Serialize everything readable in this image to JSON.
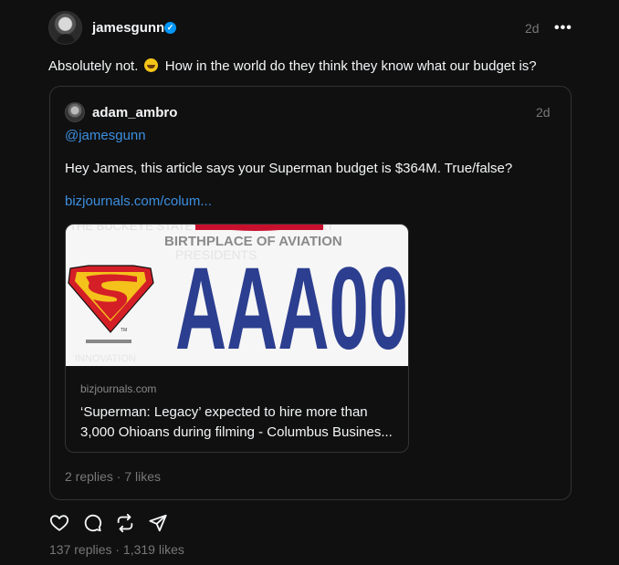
{
  "post": {
    "username": "jamesgunn",
    "time": "2d",
    "more_icon": "more-horizontal-icon",
    "text_before": "Absolutely not.",
    "emoji": "grinning-squinting-face",
    "text_after": "How in the world do they think they know what our budget is?",
    "stats": "137 replies · 1,319 likes"
  },
  "quote": {
    "username": "adam_ambro",
    "time": "2d",
    "mention": "@jamesgunn",
    "text": "Hey James, this article says your Superman budget is $364M. True/false?",
    "link": "bizjournals.com/colum...",
    "card": {
      "image_heading": "BIRTHPLACE OF AVIATION",
      "image_plate": "AAA00",
      "domain": "bizjournals.com",
      "title": "‘Superman: Legacy’ expected to hire more than 3,000 Ohioans during filming - Columbus Busines..."
    },
    "stats": "2 replies · 7 likes"
  },
  "actions": [
    "heart-icon",
    "comment-icon",
    "repost-icon",
    "share-icon"
  ],
  "colors": {
    "background": "#101010",
    "link": "#3c8fe0",
    "verified": "#0095f6",
    "muted": "#777777",
    "plate_blue": "#2c3e8f"
  }
}
